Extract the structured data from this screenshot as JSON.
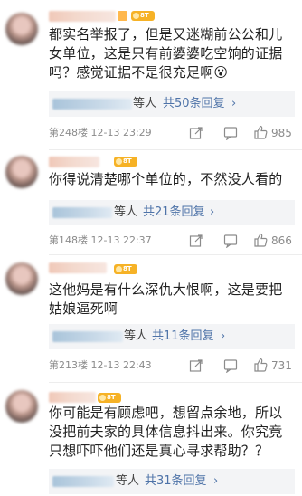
{
  "comments": [
    {
      "text": "都实名举报了，但是又迷糊前公公和儿女单位，这是只有前婆婆吃空饷的证据吗？感觉证据不是很充足啊",
      "emoji": "😮",
      "reply_suffix": "等人",
      "reply_link": "共50条回复",
      "floor": "第248楼",
      "time": "12-13 23:29",
      "likes": "985",
      "badge": "8T"
    },
    {
      "text": "你得说清楚哪个单位的，不然没人看的",
      "reply_suffix": "等人",
      "reply_link": "共21条回复",
      "floor": "第148楼",
      "time": "12-13 22:37",
      "likes": "866",
      "badge": "8T"
    },
    {
      "text": "这他妈是有什么深仇大恨啊，这是要把姑娘逼死啊",
      "reply_suffix": "等人",
      "reply_link": "共11条回复",
      "floor": "第213楼",
      "time": "12-13 22:43",
      "likes": "731",
      "badge": "8T"
    },
    {
      "text": "你可能是有顾虑吧，想留点余地，所以没把前夫家的具体信息抖出来。你究竟只想吓吓他们还是真心寻求帮助？？",
      "reply_suffix": "等人",
      "reply_link": "共31条回复",
      "badge": "8T"
    }
  ],
  "icons": {
    "share": "share-icon",
    "comment": "comment-icon",
    "like": "like-icon",
    "chevron": "chevron-right-icon"
  },
  "colors": {
    "link": "#4e73a8",
    "meta": "#8b8b8b",
    "reply_bg": "#f3f4f6",
    "badge": "#f6b226"
  }
}
